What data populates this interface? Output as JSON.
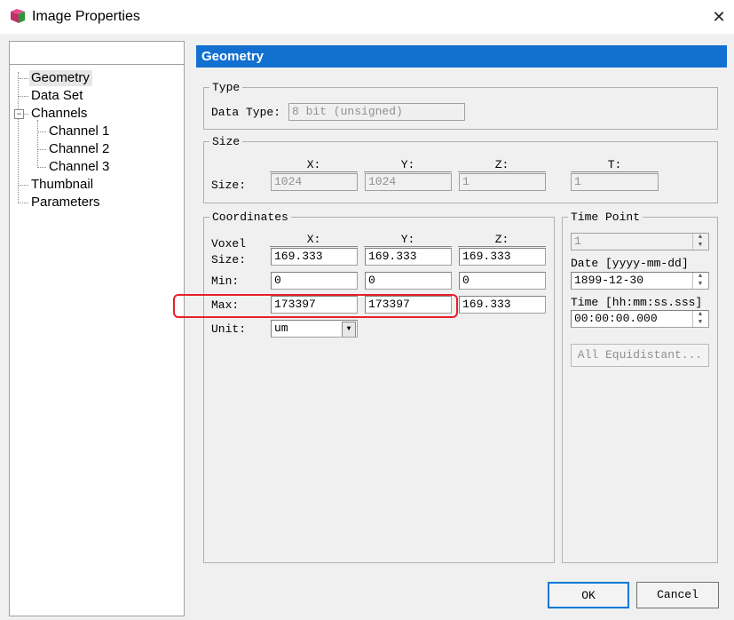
{
  "window": {
    "title": "Image Properties",
    "close": "✕"
  },
  "tree": {
    "items": [
      {
        "label": "Geometry"
      },
      {
        "label": "Data Set"
      },
      {
        "label": "Channels"
      },
      {
        "label": "Channel 1"
      },
      {
        "label": "Channel 2"
      },
      {
        "label": "Channel 3"
      },
      {
        "label": "Thumbnail"
      },
      {
        "label": "Parameters"
      }
    ],
    "collapse_symbol": "−"
  },
  "header": {
    "title": "Geometry"
  },
  "type_group": {
    "title": "Type",
    "data_type_label": "Data Type:",
    "data_type_value": "8 bit (unsigned)"
  },
  "size_group": {
    "title": "Size",
    "row_label": "Size:",
    "columns": {
      "x": "X:",
      "y": "Y:",
      "z": "Z:",
      "t": "T:"
    },
    "values": {
      "x": "1024",
      "y": "1024",
      "z": "1",
      "t": "1"
    }
  },
  "coord_group": {
    "title": "Coordinates",
    "columns": {
      "x": "X:",
      "y": "Y:",
      "z": "Z:"
    },
    "voxel_label_1": "Voxel",
    "voxel_label_2": "Size:",
    "voxel": {
      "x": "169.333",
      "y": "169.333",
      "z": "169.333"
    },
    "min_label": "Min:",
    "min": {
      "x": "0",
      "y": "0",
      "z": "0"
    },
    "max_label": "Max:",
    "max": {
      "x": "173397",
      "y": "173397",
      "z": "169.333"
    },
    "unit_label": "Unit:",
    "unit_value": "um"
  },
  "time_group": {
    "title": "Time Point",
    "point_value": "1",
    "date_label": "Date [yyyy-mm-dd]",
    "date_value": "1899-12-30",
    "time_label": "Time [hh:mm:ss.sss]",
    "time_value": "00:00:00.000",
    "equidistant_label": "All Equidistant..."
  },
  "buttons": {
    "ok": "OK",
    "cancel": "Cancel"
  },
  "colors": {
    "header_bg": "#1170d0",
    "highlight": "#e8202a"
  }
}
